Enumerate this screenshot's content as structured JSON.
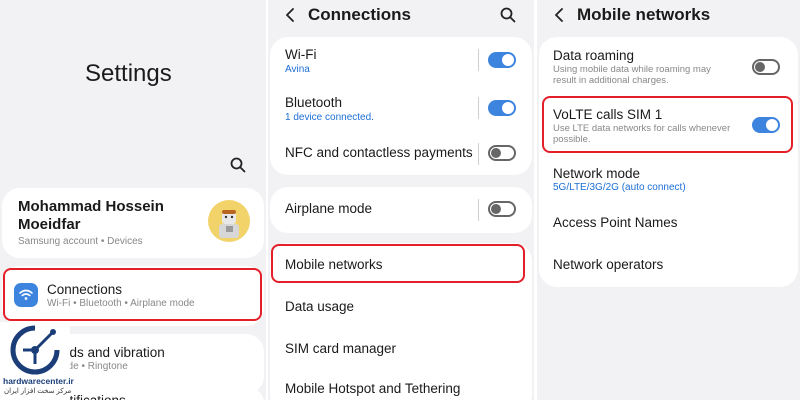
{
  "settings": {
    "title": "Settings",
    "profile": {
      "name_line1": "Mohammad Hossein",
      "name_line2": "Moeidfar",
      "subtitle": "Samsung account  •  Devices"
    },
    "connections": {
      "label": "Connections",
      "subtitle": "Wi-Fi  •  Bluetooth  •  Airplane mode"
    },
    "sounds": {
      "label": "nds and vibration",
      "subtitle": "ode  •  Ringtone"
    },
    "notifications": {
      "label": "otifications"
    }
  },
  "connections": {
    "title": "Connections",
    "wifi": {
      "label": "Wi-Fi",
      "value": "Avina",
      "on": true
    },
    "bluetooth": {
      "label": "Bluetooth",
      "value": "1 device connected.",
      "on": true
    },
    "nfc": {
      "label": "NFC and contactless payments",
      "on": false
    },
    "airplane": {
      "label": "Airplane mode",
      "on": false
    },
    "mobile_networks": {
      "label": "Mobile networks"
    },
    "data_usage": {
      "label": "Data usage"
    },
    "sim_manager": {
      "label": "SIM card manager"
    },
    "hotspot": {
      "label": "Mobile Hotspot and Tethering"
    }
  },
  "mobile_networks": {
    "title": "Mobile networks",
    "roaming": {
      "label": "Data roaming",
      "desc": "Using mobile data while roaming may result in additional charges.",
      "on": false
    },
    "volte": {
      "label": "VoLTE calls SIM 1",
      "desc": "Use LTE data networks for calls whenever possible.",
      "on": true
    },
    "network_mode": {
      "label": "Network mode",
      "value": "5G/LTE/3G/2G (auto connect)"
    },
    "apn": {
      "label": "Access Point Names"
    },
    "operators": {
      "label": "Network operators"
    }
  },
  "watermark": {
    "brand": "hardwarecenter.ir",
    "tagline": "مرکز سخت افزار ایران"
  },
  "colors": {
    "highlight": "#e3202a",
    "accent": "#3d84de",
    "link": "#1d6fd6",
    "background": "#f2f2f4"
  }
}
